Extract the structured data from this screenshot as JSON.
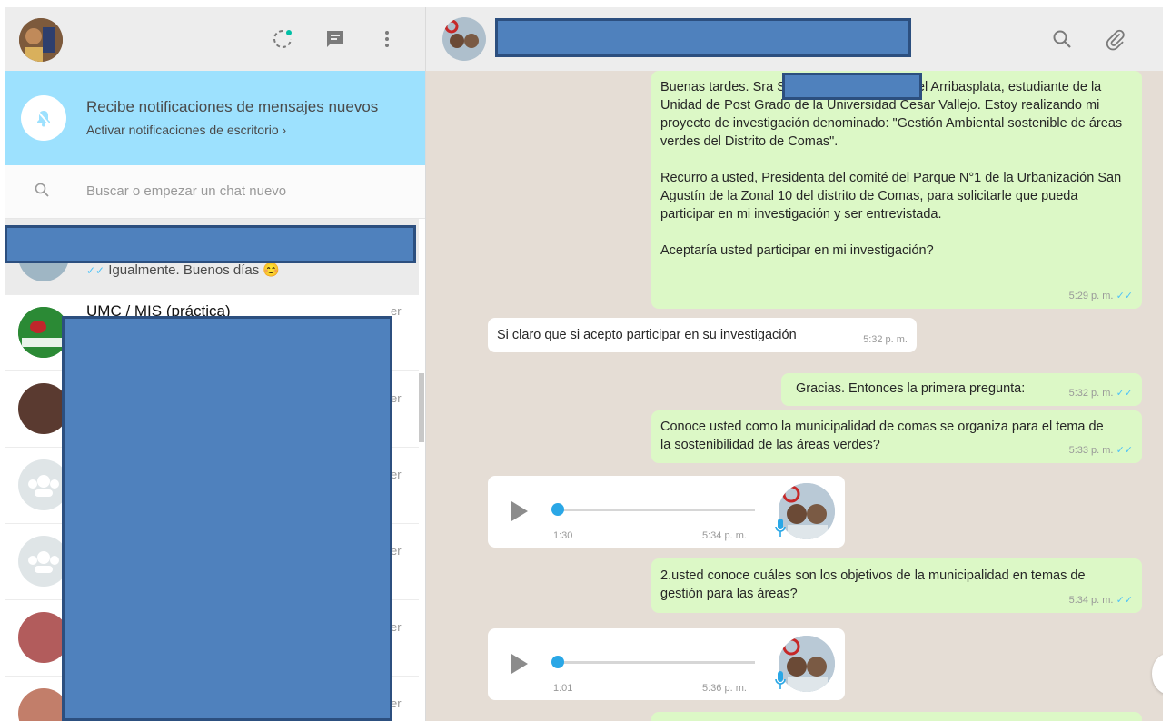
{
  "sidebar": {
    "header_icons": [
      "status-icon",
      "new-chat-icon",
      "menu-icon"
    ],
    "notification": {
      "title": "Recibe notificaciones de mensajes nuevos",
      "subtitle": "Activar notificaciones de escritorio ›"
    },
    "search_placeholder": "Buscar o empezar un chat nuevo",
    "chats": [
      {
        "preview": "Igualmente. Buenos días 😊",
        "ticks": "✓✓"
      },
      {
        "name_partial": "UMC / MIS (práctica)",
        "side": "er"
      },
      {
        "side": "er"
      },
      {
        "side": "er"
      },
      {
        "side": "er"
      },
      {
        "side": "er"
      },
      {
        "side": "er"
      }
    ]
  },
  "conversation": {
    "header_icons": [
      "search-icon",
      "attach-icon"
    ],
    "messages": [
      {
        "type": "out",
        "paragraphs": [
          "Buenas tardes. Sra                                     Soy el Mg. José Carbonel Arribasplata, estudiante de la Unidad de Post Grado de la Universidad Cesar Vallejo. Estoy realizando mi proyecto de investigación denominado: \"Gestión Ambiental sostenible de áreas verdes del Distrito de Comas\".",
          "Recurro a usted, Presidenta del comité del Parque N°1 de la Urbanización San Agustín de la Zonal 10 del distrito de Comas, para solicitarle que pueda participar en mi investigación y ser entrevistada.",
          "Aceptaría usted participar en mi investigación?"
        ],
        "time": "5:29 p. m."
      },
      {
        "type": "in",
        "text": "Si claro que si acepto participar en su investigación",
        "time": "5:32 p. m."
      },
      {
        "type": "out",
        "text": "Gracias. Entonces la primera pregunta:",
        "time": "5:32 p. m."
      },
      {
        "type": "out",
        "text": "Conoce usted como la municipalidad de comas se organiza para el tema de la sostenibilidad de las áreas verdes?",
        "time": "5:33 p. m."
      },
      {
        "type": "voice",
        "duration": "1:30",
        "time": "5:34 p. m."
      },
      {
        "type": "out",
        "text": "2.usted conoce cuáles son los objetivos de la municipalidad en temas de gestión para las áreas?",
        "time": "5:34 p. m."
      },
      {
        "type": "voice",
        "duration": "1:01",
        "time": "5:36 p. m."
      }
    ],
    "read_ticks": "✓✓"
  },
  "colors": {
    "notification_bg": "#9de1fe",
    "outgoing_bubble": "#dcf8c6",
    "chat_bg": "#e5ddd5",
    "redaction": "#4f81bd",
    "read_tick": "#4fc3f7"
  }
}
